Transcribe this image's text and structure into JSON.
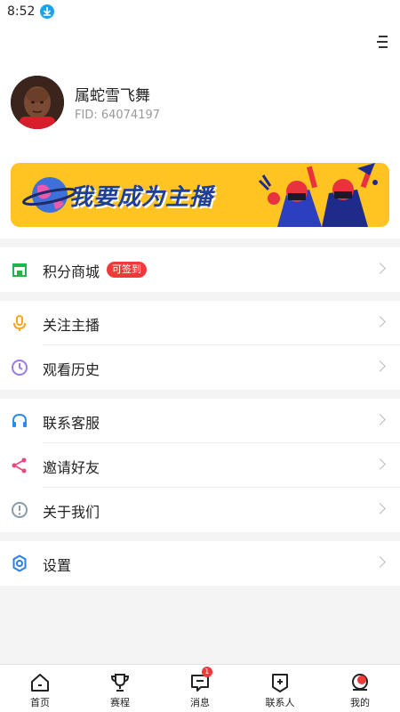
{
  "status_bar": {
    "time": "8:52",
    "download_icon": "download-arrow-icon"
  },
  "profile": {
    "menu_icon": "menu-lines-icon",
    "username": "属蛇雪飞舞",
    "fid": "FID: 64074197"
  },
  "banner": {
    "text": "我要成为主播",
    "background": "#ffc422",
    "text_color": "#1e3f9a"
  },
  "sections": [
    {
      "items": [
        {
          "label": "积分商城",
          "icon": "store-icon",
          "icon_color": "#21b54b",
          "badge": "可签到"
        }
      ]
    },
    {
      "items": [
        {
          "label": "关注主播",
          "icon": "microphone-icon",
          "icon_color": "#f5a623"
        },
        {
          "label": "观看历史",
          "icon": "clock-icon",
          "icon_color": "#9b7be0"
        }
      ]
    },
    {
      "items": [
        {
          "label": "联系客服",
          "icon": "headset-icon",
          "icon_color": "#2a8ce8"
        },
        {
          "label": "邀请好友",
          "icon": "share-icon",
          "icon_color": "#f0447a"
        },
        {
          "label": "关于我们",
          "icon": "info-exclamation-icon",
          "icon_color": "#8a9aa8"
        }
      ]
    },
    {
      "items": [
        {
          "label": "设置",
          "icon": "gear-icon",
          "icon_color": "#2a7ee8"
        }
      ]
    }
  ],
  "tabbar": {
    "tabs": [
      {
        "label": "首页",
        "icon": "home-icon"
      },
      {
        "label": "赛程",
        "icon": "trophy-icon"
      },
      {
        "label": "消息",
        "icon": "message-icon",
        "badge": "1"
      },
      {
        "label": "联系人",
        "icon": "contacts-icon"
      },
      {
        "label": "我的",
        "icon": "profile-icon"
      }
    ],
    "badge_color": "#f03a3a"
  }
}
